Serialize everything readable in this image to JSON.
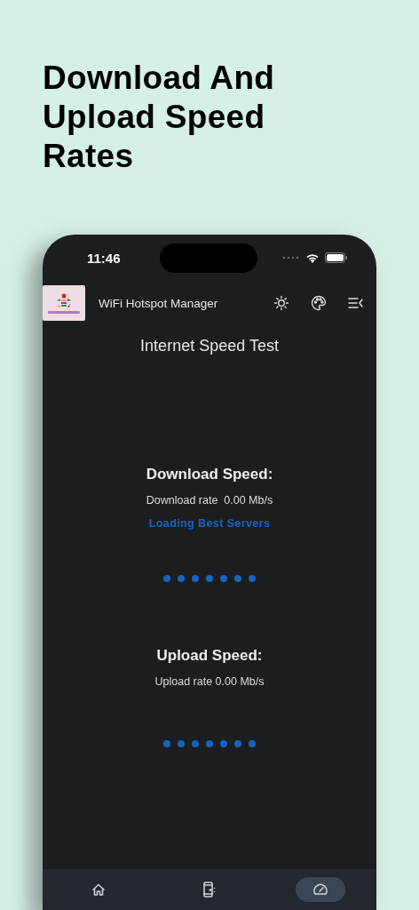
{
  "heading": "Download And Upload Speed Rates",
  "status_bar": {
    "time": "11:46"
  },
  "app_bar": {
    "title": "WiFi Hotspot Manager"
  },
  "page_title": "Internet Speed Test",
  "sections": [
    {
      "title": "Download Speed:",
      "rate": "Download rate  0.00 Mb/s",
      "status": "Loading Best Servers"
    },
    {
      "title": "Upload Speed:",
      "rate": "Upload rate 0.00 Mb/s"
    }
  ],
  "bottom_nav": [
    {
      "kind": "home",
      "selected": false
    },
    {
      "kind": "device",
      "selected": false
    },
    {
      "kind": "speed",
      "selected": true
    }
  ]
}
